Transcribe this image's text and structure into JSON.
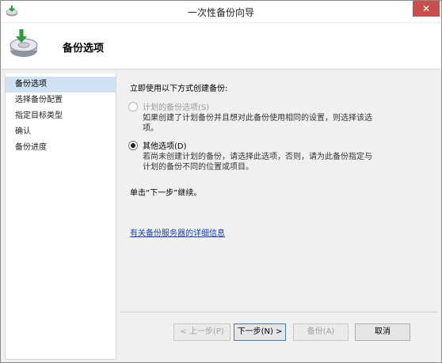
{
  "window": {
    "title": "一次性备份向导",
    "close_label": "✕"
  },
  "header": {
    "title": "备份选项"
  },
  "nav": {
    "items": [
      {
        "label": "备份选项",
        "active": true
      },
      {
        "label": "选择备份配置",
        "active": false
      },
      {
        "label": "指定目标类型",
        "active": false
      },
      {
        "label": "确认",
        "active": false
      },
      {
        "label": "备份进度",
        "active": false
      }
    ]
  },
  "main": {
    "instruction": "立即使用以下方式创建备份:",
    "options": [
      {
        "label": "计划的备份选项(S)",
        "checked": false,
        "disabled": true,
        "description": "如果创建了计划备份并且想对此备份使用相同的设置，则选择该选项。"
      },
      {
        "label": "其他选项(D)",
        "checked": true,
        "disabled": false,
        "description": "若尚未创建计划的备份，请选择此选项，否则，请为此备份指定与计划的备份不同的位置或项目。"
      }
    ],
    "continue_note": "单击“下一步”继续。",
    "more_info_link": "有关备份服务器的详细信息"
  },
  "footer": {
    "prev_label": "< 上一步(P)",
    "next_label": "下一步(N) >",
    "backup_label": "备份(A)",
    "cancel_label": "取消"
  },
  "colors": {
    "nav_selected": "#cfe1f3",
    "link": "#1b3fa8",
    "close_button": "#c7504c"
  }
}
